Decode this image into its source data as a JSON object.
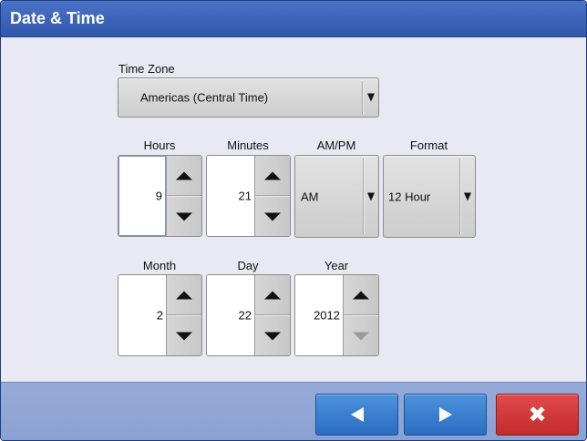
{
  "window": {
    "title": "Date & Time"
  },
  "time_zone": {
    "label": "Time Zone",
    "value": "Americas (Central Time)",
    "icon": "dropdown-arrow-icon"
  },
  "time": {
    "hours": {
      "label": "Hours",
      "value": "9"
    },
    "minutes": {
      "label": "Minutes",
      "value": "21"
    },
    "ampm": {
      "label": "AM/PM",
      "value": "AM"
    },
    "format": {
      "label": "Format",
      "value": "12 Hour"
    }
  },
  "date": {
    "month": {
      "label": "Month",
      "value": "2"
    },
    "day": {
      "label": "Day",
      "value": "22"
    },
    "year": {
      "label": "Year",
      "value": "2012",
      "down_disabled": true
    }
  },
  "footer": {
    "back_icon": "left-arrow-icon",
    "next_icon": "right-arrow-icon",
    "cancel_glyph": "✖",
    "colors": {
      "nav": "#2f76c8",
      "cancel": "#d23838"
    }
  }
}
